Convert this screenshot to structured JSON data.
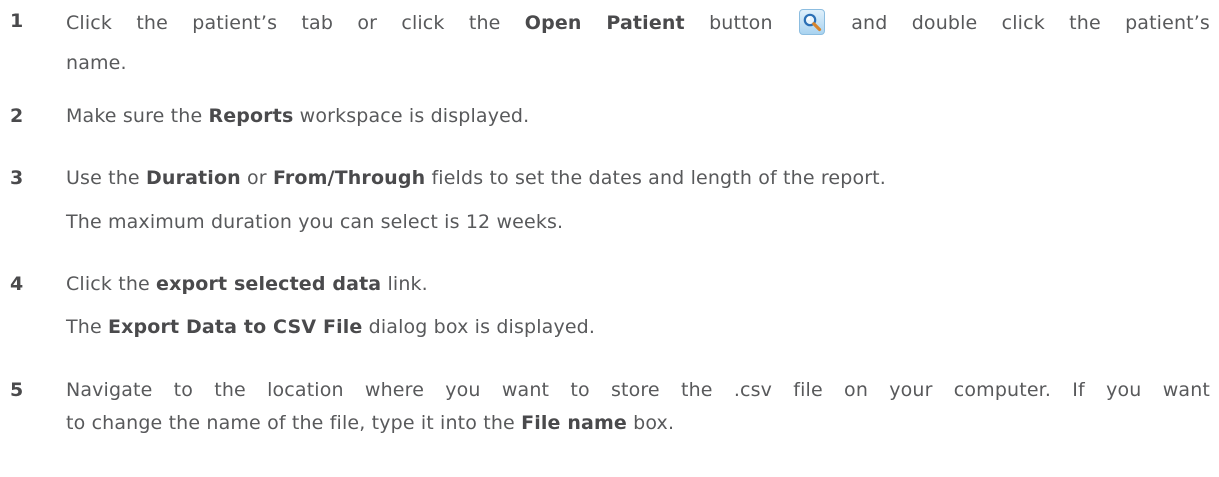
{
  "steps": [
    {
      "number": "1",
      "line1": {
        "part1": "Click the patient’s tab or click the ",
        "bold1": "Open Patient",
        "part2": " button ",
        "part3": " and double click the patient’s"
      },
      "line2": "name.",
      "icon": "magnifier-icon"
    },
    {
      "number": "2",
      "part1": "Make sure the ",
      "bold1": "Reports",
      "part2": " workspace is displayed."
    },
    {
      "number": "3",
      "part1": "Use the ",
      "bold1": "Duration",
      "part2": " or ",
      "bold2": "From/Through",
      "part3": " fields to set the dates and length of the report.",
      "note": "The maximum duration you can select is 12 weeks."
    },
    {
      "number": "4",
      "part1": "Click the ",
      "bold1": "export selected data",
      "part2": " link.",
      "note_part1": "The ",
      "note_bold1": "Export Data to CSV File",
      "note_part2": " dialog box is displayed."
    },
    {
      "number": "5",
      "line1": "Navigate to the location where you want to store the .csv file on your computer. If you want",
      "line2_part1": "to change the name of the file, type it into the ",
      "line2_bold1": "File name",
      "line2_part2": " box."
    }
  ],
  "colors": {
    "text": "#58595b",
    "bold": "#4a4a4c",
    "icon_bg": "#a9d3f0"
  }
}
